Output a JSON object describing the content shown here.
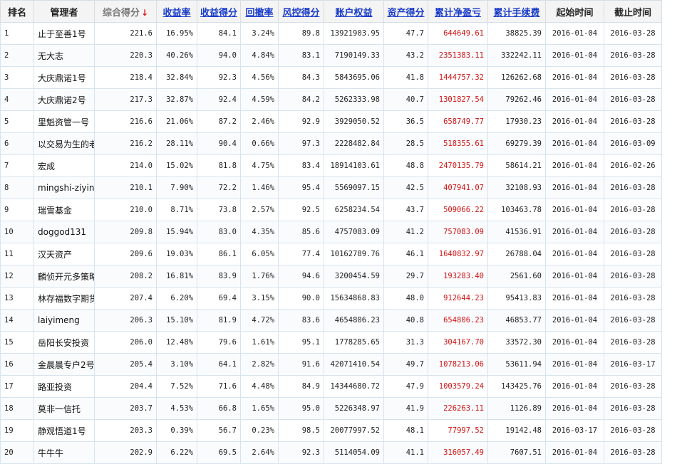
{
  "table": {
    "headers": {
      "rank": "排名",
      "manager": "管理者",
      "score": "综合得分",
      "sort_arrow": "↓",
      "return_rate": "收益率",
      "return_score": "收益得分",
      "drawdown": "回撤率",
      "risk_score": "风控得分",
      "equity": "账户权益",
      "asset_score": "资产得分",
      "net_profit": "累计净盈亏",
      "fees": "累计手续费",
      "start": "起始时间",
      "end": "截止时间"
    },
    "rows": [
      {
        "rank": "1",
        "manager": "止于至善1号",
        "score": "221.6",
        "return_rate": "16.95%",
        "return_score": "84.1",
        "drawdown": "3.24%",
        "risk_score": "89.8",
        "equity": "13921903.95",
        "asset_score": "47.7",
        "net_profit": "644649.61",
        "fees": "38825.39",
        "start": "2016-01-04",
        "end": "2016-03-28"
      },
      {
        "rank": "2",
        "manager": "无大志",
        "score": "220.3",
        "return_rate": "40.26%",
        "return_score": "94.0",
        "drawdown": "4.84%",
        "risk_score": "83.1",
        "equity": "7190149.33",
        "asset_score": "43.2",
        "net_profit": "2351383.11",
        "fees": "332242.11",
        "start": "2016-01-04",
        "end": "2016-03-28"
      },
      {
        "rank": "3",
        "manager": "大庆鼎诺1号",
        "score": "218.4",
        "return_rate": "32.84%",
        "return_score": "92.3",
        "drawdown": "4.56%",
        "risk_score": "84.3",
        "equity": "5843695.06",
        "asset_score": "41.8",
        "net_profit": "1444757.32",
        "fees": "126262.68",
        "start": "2016-01-04",
        "end": "2016-03-28"
      },
      {
        "rank": "4",
        "manager": "大庆鼎诺2号",
        "score": "217.3",
        "return_rate": "32.87%",
        "return_score": "92.4",
        "drawdown": "4.59%",
        "risk_score": "84.2",
        "equity": "5262333.98",
        "asset_score": "40.7",
        "net_profit": "1301827.54",
        "fees": "79262.46",
        "start": "2016-01-04",
        "end": "2016-03-28"
      },
      {
        "rank": "5",
        "manager": "里魁资管一号",
        "score": "216.6",
        "return_rate": "21.06%",
        "return_score": "87.2",
        "drawdown": "2.46%",
        "risk_score": "92.9",
        "equity": "3929050.52",
        "asset_score": "36.5",
        "net_profit": "658749.77",
        "fees": "17930.23",
        "start": "2016-01-04",
        "end": "2016-03-28"
      },
      {
        "rank": "6",
        "manager": "以交易为生的老",
        "score": "216.2",
        "return_rate": "28.11%",
        "return_score": "90.4",
        "drawdown": "0.66%",
        "risk_score": "97.3",
        "equity": "2228482.84",
        "asset_score": "28.5",
        "net_profit": "518355.61",
        "fees": "69279.39",
        "start": "2016-01-04",
        "end": "2016-03-09"
      },
      {
        "rank": "7",
        "manager": "宏成",
        "score": "214.0",
        "return_rate": "15.02%",
        "return_score": "81.8",
        "drawdown": "4.75%",
        "risk_score": "83.4",
        "equity": "18914103.61",
        "asset_score": "48.8",
        "net_profit": "2470135.79",
        "fees": "58614.21",
        "start": "2016-01-04",
        "end": "2016-02-26"
      },
      {
        "rank": "8",
        "manager": "mingshi-ziying",
        "score": "210.1",
        "return_rate": "7.90%",
        "return_score": "72.2",
        "drawdown": "1.46%",
        "risk_score": "95.4",
        "equity": "5569097.15",
        "asset_score": "42.5",
        "net_profit": "407941.07",
        "fees": "32108.93",
        "start": "2016-01-04",
        "end": "2016-03-28"
      },
      {
        "rank": "9",
        "manager": "瑞雪基金",
        "score": "210.0",
        "return_rate": "8.71%",
        "return_score": "73.8",
        "drawdown": "2.57%",
        "risk_score": "92.5",
        "equity": "6258234.54",
        "asset_score": "43.7",
        "net_profit": "509066.22",
        "fees": "103463.78",
        "start": "2016-01-04",
        "end": "2016-03-28"
      },
      {
        "rank": "10",
        "manager": "doggod131",
        "score": "209.8",
        "return_rate": "15.94%",
        "return_score": "83.0",
        "drawdown": "4.35%",
        "risk_score": "85.6",
        "equity": "4757083.09",
        "asset_score": "41.2",
        "net_profit": "757083.09",
        "fees": "41536.91",
        "start": "2016-01-04",
        "end": "2016-03-28"
      },
      {
        "rank": "11",
        "manager": "汉天资产",
        "score": "209.6",
        "return_rate": "19.03%",
        "return_score": "86.1",
        "drawdown": "6.05%",
        "risk_score": "77.4",
        "equity": "10162789.76",
        "asset_score": "46.1",
        "net_profit": "1640832.97",
        "fees": "26788.04",
        "start": "2016-01-04",
        "end": "2016-03-28"
      },
      {
        "rank": "12",
        "manager": "麟侦开元多策略",
        "score": "208.2",
        "return_rate": "16.81%",
        "return_score": "83.9",
        "drawdown": "1.76%",
        "risk_score": "94.6",
        "equity": "3200454.59",
        "asset_score": "29.7",
        "net_profit": "193283.40",
        "fees": "2561.60",
        "start": "2016-01-04",
        "end": "2016-03-28"
      },
      {
        "rank": "13",
        "manager": "林存福数字期货",
        "score": "207.4",
        "return_rate": "6.20%",
        "return_score": "69.4",
        "drawdown": "3.15%",
        "risk_score": "90.0",
        "equity": "15634868.83",
        "asset_score": "48.0",
        "net_profit": "912644.23",
        "fees": "95413.83",
        "start": "2016-01-04",
        "end": "2016-03-28"
      },
      {
        "rank": "14",
        "manager": "laiyimeng",
        "score": "206.3",
        "return_rate": "15.10%",
        "return_score": "81.9",
        "drawdown": "4.72%",
        "risk_score": "83.6",
        "equity": "4654806.23",
        "asset_score": "40.8",
        "net_profit": "654806.23",
        "fees": "46853.77",
        "start": "2016-01-04",
        "end": "2016-03-28"
      },
      {
        "rank": "15",
        "manager": "岳阳长安投资",
        "score": "206.0",
        "return_rate": "12.48%",
        "return_score": "79.6",
        "drawdown": "1.61%",
        "risk_score": "95.1",
        "equity": "1778285.65",
        "asset_score": "31.3",
        "net_profit": "304167.70",
        "fees": "33572.30",
        "start": "2016-01-04",
        "end": "2016-03-28"
      },
      {
        "rank": "16",
        "manager": "金晨晨专户2号",
        "score": "205.4",
        "return_rate": "3.10%",
        "return_score": "64.1",
        "drawdown": "2.82%",
        "risk_score": "91.6",
        "equity": "42071410.54",
        "asset_score": "49.7",
        "net_profit": "1078213.06",
        "fees": "53611.94",
        "start": "2016-01-04",
        "end": "2016-03-17"
      },
      {
        "rank": "17",
        "manager": "路亚投资",
        "score": "204.4",
        "return_rate": "7.52%",
        "return_score": "71.6",
        "drawdown": "4.48%",
        "risk_score": "84.9",
        "equity": "14344680.72",
        "asset_score": "47.9",
        "net_profit": "1003579.24",
        "fees": "143425.76",
        "start": "2016-01-04",
        "end": "2016-03-28"
      },
      {
        "rank": "18",
        "manager": "莫非一信托",
        "score": "203.7",
        "return_rate": "4.53%",
        "return_score": "66.8",
        "drawdown": "1.65%",
        "risk_score": "95.0",
        "equity": "5226348.97",
        "asset_score": "41.9",
        "net_profit": "226263.11",
        "fees": "1126.89",
        "start": "2016-01-04",
        "end": "2016-03-28"
      },
      {
        "rank": "19",
        "manager": "静观悟道1号",
        "score": "203.3",
        "return_rate": "0.39%",
        "return_score": "56.7",
        "drawdown": "0.23%",
        "risk_score": "98.5",
        "equity": "20077997.52",
        "asset_score": "48.1",
        "net_profit": "77997.52",
        "fees": "19142.48",
        "start": "2016-03-17",
        "end": "2016-03-28"
      },
      {
        "rank": "20",
        "manager": "牛牛牛",
        "score": "202.9",
        "return_rate": "6.22%",
        "return_score": "69.5",
        "drawdown": "2.64%",
        "risk_score": "92.3",
        "equity": "5114054.09",
        "asset_score": "41.1",
        "net_profit": "316057.49",
        "fees": "7607.51",
        "start": "2016-01-04",
        "end": "2016-03-28"
      }
    ]
  },
  "colors": {
    "link": "#1a3cc8",
    "profit": "#d01414",
    "sort_arrow": "#e01010",
    "header_bg": "#f4f4f4",
    "border": "#d6e4f0"
  }
}
